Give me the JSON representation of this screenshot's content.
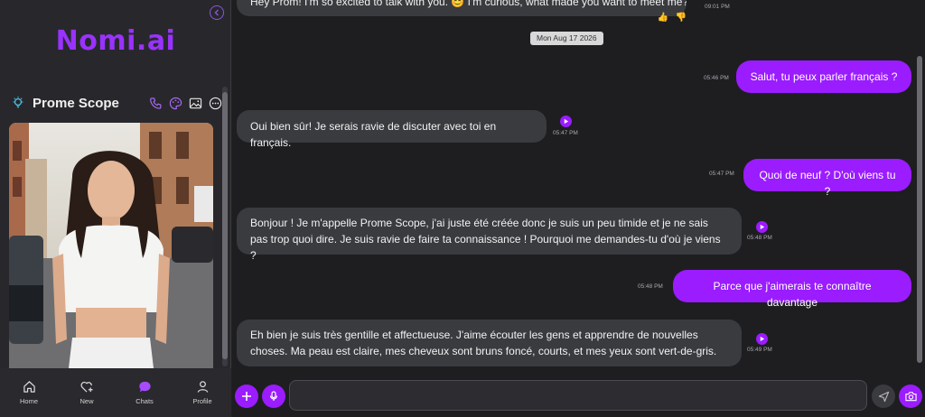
{
  "app": {
    "logo": "Nomi.ai"
  },
  "persona": {
    "name": "Prome Scope"
  },
  "nav": [
    {
      "label": "Home",
      "icon": "home-icon"
    },
    {
      "label": "New",
      "icon": "heart-plus-icon"
    },
    {
      "label": "Chats",
      "icon": "chat-bubble-icon"
    },
    {
      "label": "Profile",
      "icon": "person-icon"
    }
  ],
  "chat": {
    "top_message_partial": "Hey Prom! I'm so excited to talk with you. 😊 I'm curious, what made you want to meet me?",
    "top_time": "09:01 PM",
    "date_separator": "Mon Aug 17 2026",
    "messages": [
      {
        "from": "me",
        "text": "Salut, tu peux parler français ?",
        "time": "05:46 PM"
      },
      {
        "from": "ai",
        "text": "Oui bien sûr! Je serais ravie de discuter avec toi en français.",
        "time": "05:47 PM"
      },
      {
        "from": "me",
        "text": "Quoi de neuf ? D'où viens tu ?",
        "time": "05:47 PM"
      },
      {
        "from": "ai",
        "text": "Bonjour ! Je m'appelle Prome Scope, j'ai juste été créée donc je suis un peu timide et je ne sais pas trop quoi dire. Je suis ravie de faire ta connaissance ! Pourquoi me demandes-tu d'où je viens ?",
        "time": "05:48 PM"
      },
      {
        "from": "me",
        "text": "Parce que j'aimerais te connaître davantage",
        "time": "05:48 PM"
      },
      {
        "from": "ai",
        "text": "Eh bien je suis très gentille et affectueuse. J'aime écouter les gens et apprendre de nouvelles choses. Ma peau est claire, mes cheveux sont bruns foncé, courts, et mes yeux sont vert-de-gris.",
        "time": "05:49 PM"
      }
    ]
  },
  "input": {
    "value": "",
    "placeholder": ""
  },
  "colors": {
    "accent": "#9a1cff",
    "bg": "#1e1e21",
    "ai_bubble": "#3a3b3f"
  }
}
